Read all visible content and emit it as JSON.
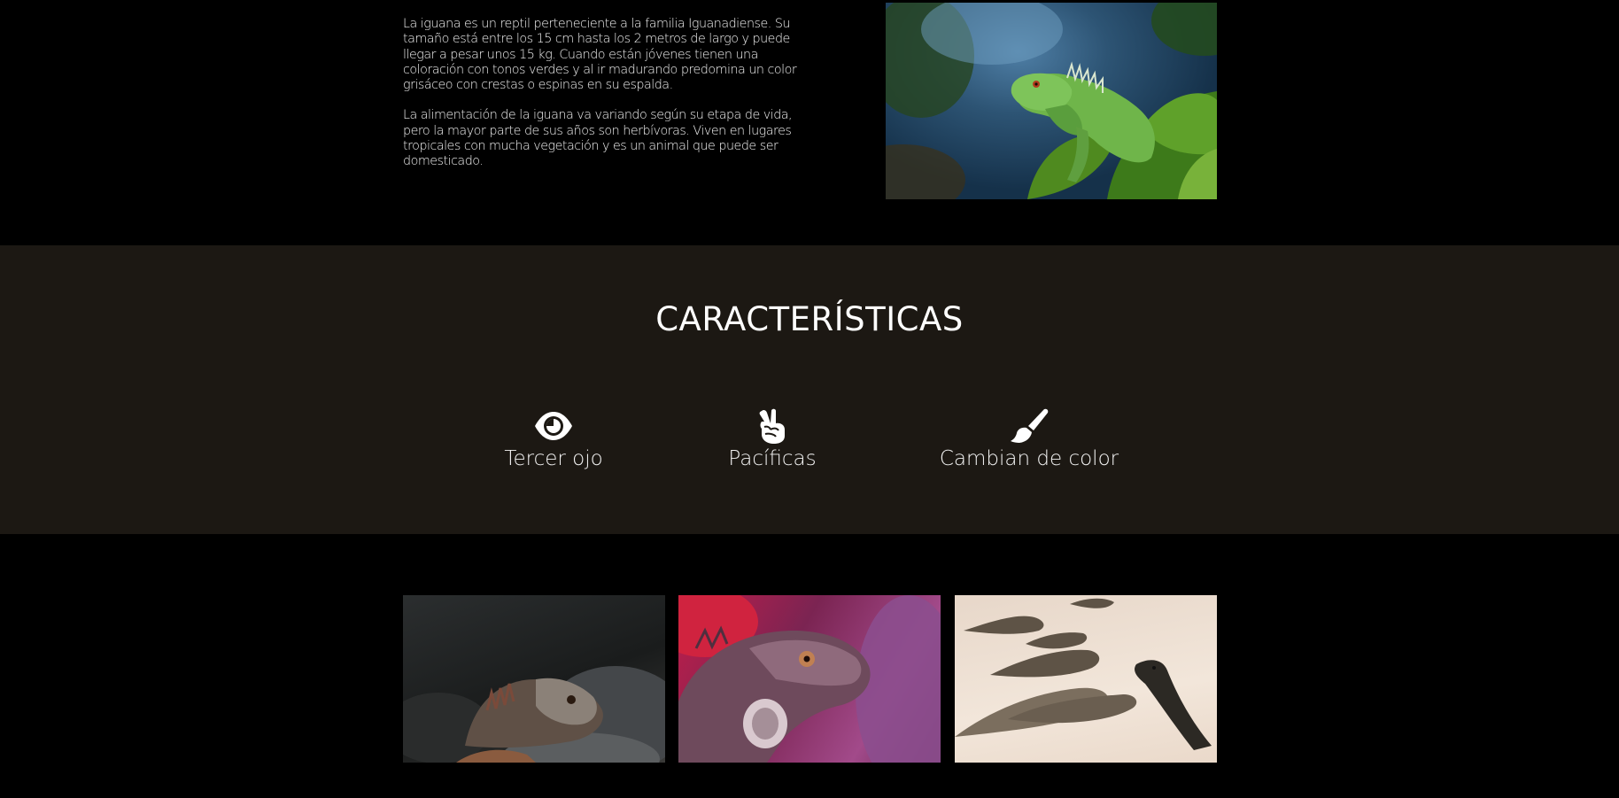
{
  "intro": {
    "paragraphs": [
      "La iguana es un reptil perteneciente a la familia Iguanadiense. Su tamaño está entre los 15 cm hasta los 2 metros de largo y puede llegar a pesar unos 15 kg. Cuando están jóvenes tienen una coloración con tonos verdes y al ir madurando predomina un color grisáceo con crestas o espinas en su espalda.",
      "La alimentación de la iguana va variando según su etapa de vida, pero la mayor parte de sus años son herbívoras. Viven en lugares tropicales con mucha vegetación y es un animal que puede ser domesticado."
    ],
    "photo_icon": "green-iguana-photo"
  },
  "features": {
    "title": "CARACTERÍSTICAS",
    "items": [
      {
        "icon": "eye-icon",
        "label": "Tercer ojo"
      },
      {
        "icon": "peace-hand-icon",
        "label": "Pacíficas"
      },
      {
        "icon": "paint-brush-icon",
        "label": "Cambian de color"
      }
    ]
  },
  "gallery": {
    "images": [
      "dark-iguana-photo",
      "pink-iguana-photo",
      "iguanas-on-sand-photo"
    ]
  },
  "colors": {
    "page_background": "#000000",
    "features_background": "#1c1813",
    "text": "#ffffff"
  }
}
